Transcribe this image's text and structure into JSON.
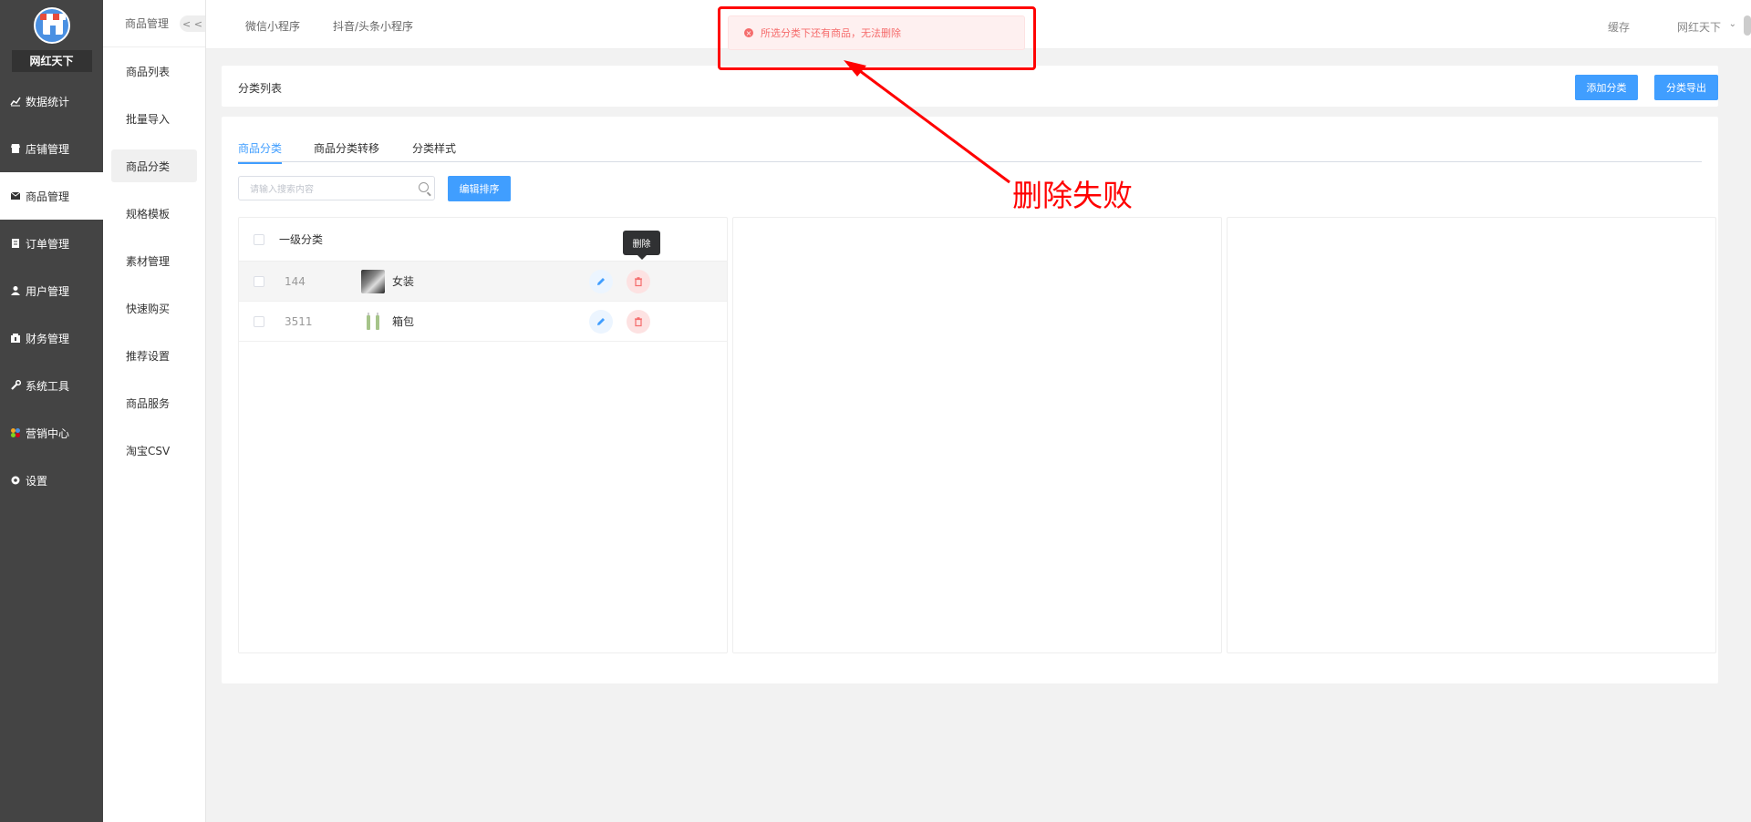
{
  "sidebar": {
    "brand": "网红天下",
    "items": [
      {
        "label": "数据统计",
        "icon": "chart-line-icon"
      },
      {
        "label": "店铺管理",
        "icon": "store-icon"
      },
      {
        "label": "商品管理",
        "icon": "goods-icon"
      },
      {
        "label": "订单管理",
        "icon": "order-icon"
      },
      {
        "label": "用户管理",
        "icon": "user-icon"
      },
      {
        "label": "财务管理",
        "icon": "finance-icon"
      },
      {
        "label": "系统工具",
        "icon": "wrench-icon"
      },
      {
        "label": "营销中心",
        "icon": "marketing-icon"
      },
      {
        "label": "设置",
        "icon": "settings-icon"
      }
    ]
  },
  "submenu": {
    "title": "商品管理",
    "collapse": "< <",
    "items": [
      "商品列表",
      "批量导入",
      "商品分类",
      "规格模板",
      "素材管理",
      "快速购买",
      "推荐设置",
      "商品服务",
      "淘宝CSV"
    ]
  },
  "topbar": {
    "tabs": [
      "微信小程序",
      "抖音/头条小程序"
    ],
    "cache": "缓存",
    "user": "网红天下"
  },
  "message": {
    "text": "所选分类下还有商品，无法删除",
    "type": "error"
  },
  "header": {
    "title": "分类列表",
    "add_button": "添加分类",
    "export_button": "分类导出"
  },
  "main": {
    "tabs": [
      "商品分类",
      "商品分类转移",
      "分类样式"
    ],
    "active_tab": "商品分类",
    "search_placeholder": "请输入搜索内容",
    "sort_button": "编辑排序",
    "panel_title": "一级分类",
    "rows": [
      {
        "id": "144",
        "name": "女装"
      },
      {
        "id": "3511",
        "name": "箱包"
      }
    ],
    "tooltip": "删除"
  },
  "annotation": {
    "text": "删除失败"
  },
  "colors": {
    "primary": "#409eff",
    "danger": "#f56c6c",
    "sidebar_bg": "#444444",
    "annotation": "#ff0000"
  }
}
